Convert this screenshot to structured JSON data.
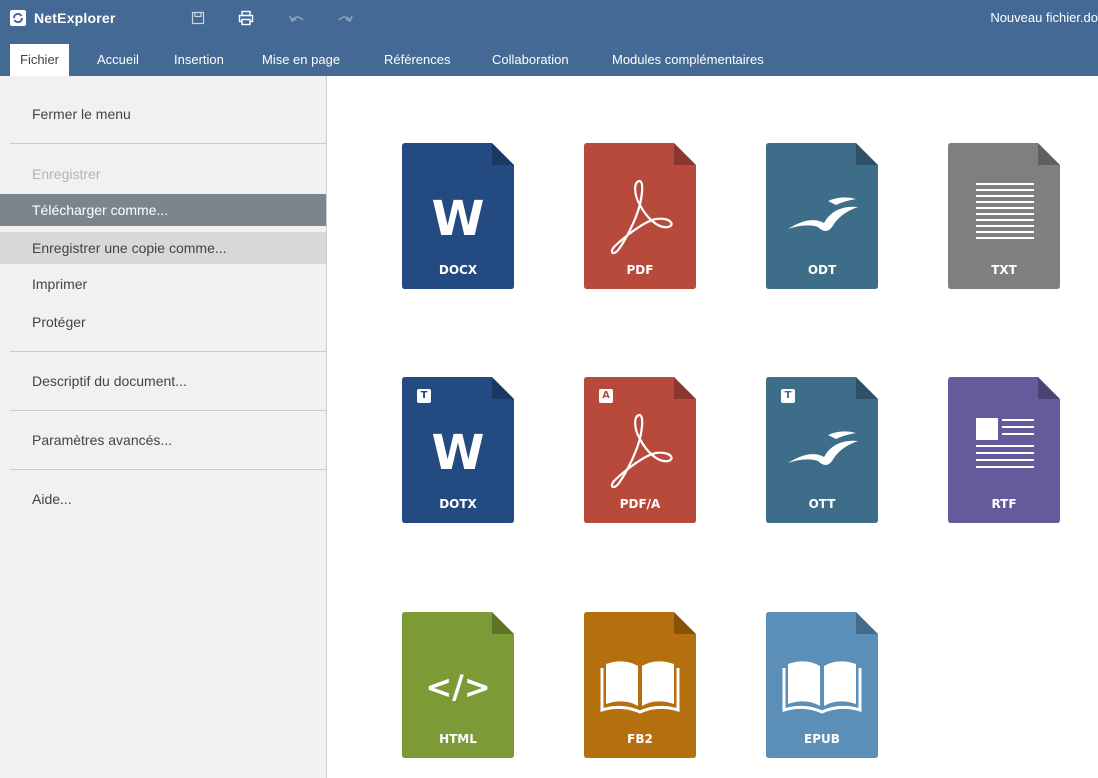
{
  "app": {
    "name": "NetExplorer",
    "doc_title": "Nouveau fichier.do"
  },
  "quick_access": [
    {
      "name": "save-icon"
    },
    {
      "name": "print-icon"
    },
    {
      "name": "undo-icon"
    },
    {
      "name": "redo-icon"
    }
  ],
  "tabs": [
    "Fichier",
    "Accueil",
    "Insertion",
    "Mise en page",
    "Références",
    "Collaboration",
    "Modules complémentaires"
  ],
  "menu": {
    "close": "Fermer le menu",
    "save": "Enregistrer",
    "download_as": "Télécharger comme...",
    "save_copy_as": "Enregistrer une copie comme...",
    "print": "Imprimer",
    "protect": "Protéger",
    "doc_info": "Descriptif du document...",
    "advanced": "Paramètres avancés...",
    "help": "Aide..."
  },
  "formats": [
    {
      "label": "DOCX",
      "color": "#234b82",
      "icon": "word-icon",
      "badge": ""
    },
    {
      "label": "PDF",
      "color": "#b84a3c",
      "icon": "pdf-icon",
      "badge": ""
    },
    {
      "label": "ODT",
      "color": "#3e6d8a",
      "icon": "openoffice-icon",
      "badge": ""
    },
    {
      "label": "TXT",
      "color": "#7f7f7f",
      "icon": "text-lines-icon",
      "badge": ""
    },
    {
      "label": "DOTX",
      "color": "#234b82",
      "icon": "word-icon",
      "badge": "T"
    },
    {
      "label": "PDF/A",
      "color": "#b84a3c",
      "icon": "pdf-icon",
      "badge": "A"
    },
    {
      "label": "OTT",
      "color": "#3e6d8a",
      "icon": "openoffice-icon",
      "badge": "T"
    },
    {
      "label": "RTF",
      "color": "#655a9b",
      "icon": "rich-text-icon",
      "badge": ""
    },
    {
      "label": "HTML",
      "color": "#7c9a36",
      "icon": "code-icon",
      "badge": ""
    },
    {
      "label": "FB2",
      "color": "#b46f0e",
      "icon": "book-icon",
      "badge": ""
    },
    {
      "label": "EPUB",
      "color": "#5b8fb8",
      "icon": "book-icon",
      "badge": ""
    }
  ]
}
